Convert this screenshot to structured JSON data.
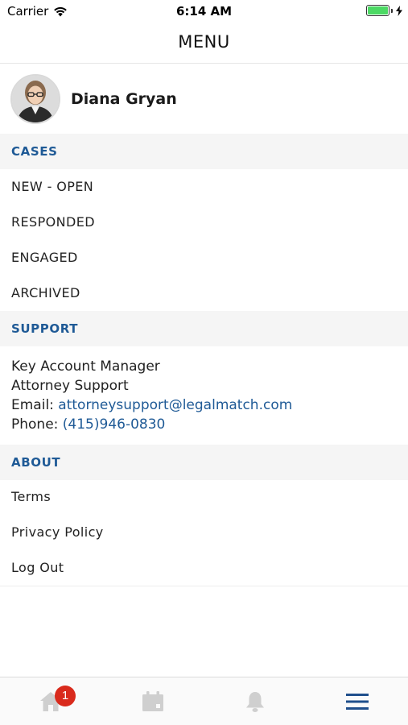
{
  "status_bar": {
    "carrier": "Carrier",
    "time": "6:14 AM"
  },
  "header": {
    "title": "MENU"
  },
  "profile": {
    "name": "Diana Gryan"
  },
  "sections": {
    "cases": {
      "title": "CASES",
      "items": [
        "NEW - OPEN",
        "RESPONDED",
        "ENGAGED",
        "ARCHIVED"
      ]
    },
    "support": {
      "title": "SUPPORT",
      "line1": "Key Account Manager",
      "line2": "Attorney Support",
      "email_label": "Email: ",
      "email": "attorneysupport@legalmatch.com",
      "phone_label": "Phone: ",
      "phone": "(415)946-0830"
    },
    "about": {
      "title": "ABOUT",
      "items": [
        "Terms",
        "Privacy Policy",
        "Log Out"
      ]
    }
  },
  "tab_bar": {
    "tabs": [
      {
        "icon": "home-icon",
        "badge": "1"
      },
      {
        "icon": "calendar-icon"
      },
      {
        "icon": "bell-icon"
      },
      {
        "icon": "menu-icon"
      }
    ],
    "colors": {
      "inactive": "#cfcfcf",
      "active": "#1f4f8c",
      "badge": "#d92a1c"
    }
  },
  "colors": {
    "section_text": "#1f5a96",
    "section_bg": "#f5f5f5",
    "battery": "#4cd964"
  }
}
